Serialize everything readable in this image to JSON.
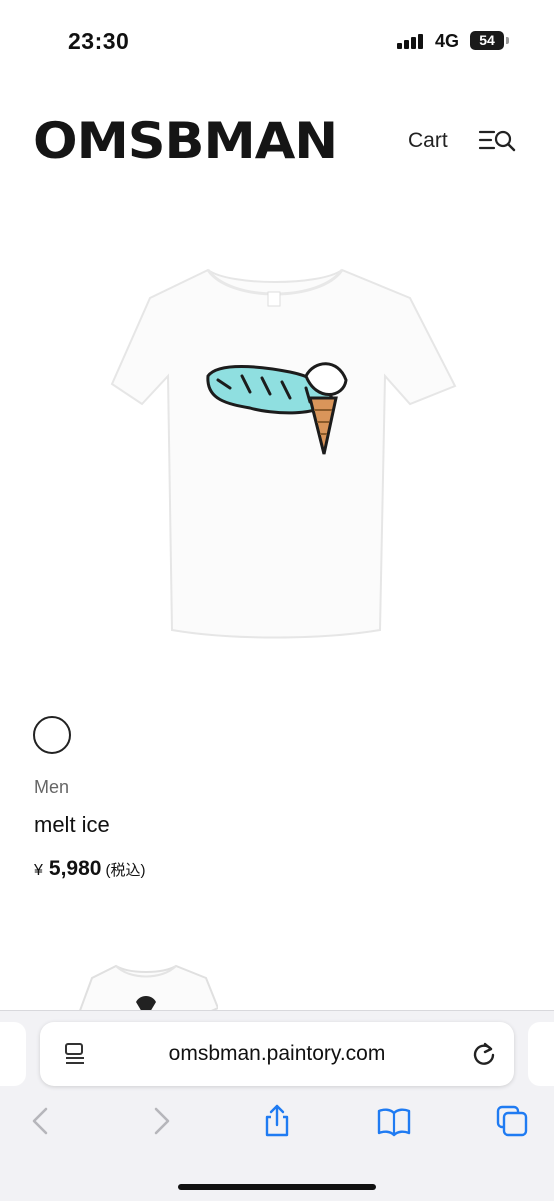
{
  "status_bar": {
    "time": "23:30",
    "network": "4G",
    "battery": "54"
  },
  "header": {
    "logo": "OMSBMAN",
    "cart_label": "Cart",
    "menu_icon": "menu-search-icon"
  },
  "product": {
    "image_icon": "tshirt-image",
    "swatch_color": "#ffffff",
    "category": "Men",
    "name": "melt ice",
    "currency": "¥",
    "price": "5,980",
    "tax_note": "(税込)"
  },
  "browser": {
    "url": "omsbman.paintory.com",
    "toolbar": [
      "back-icon",
      "forward-icon",
      "share-icon",
      "bookmarks-icon",
      "tabs-icon"
    ]
  }
}
